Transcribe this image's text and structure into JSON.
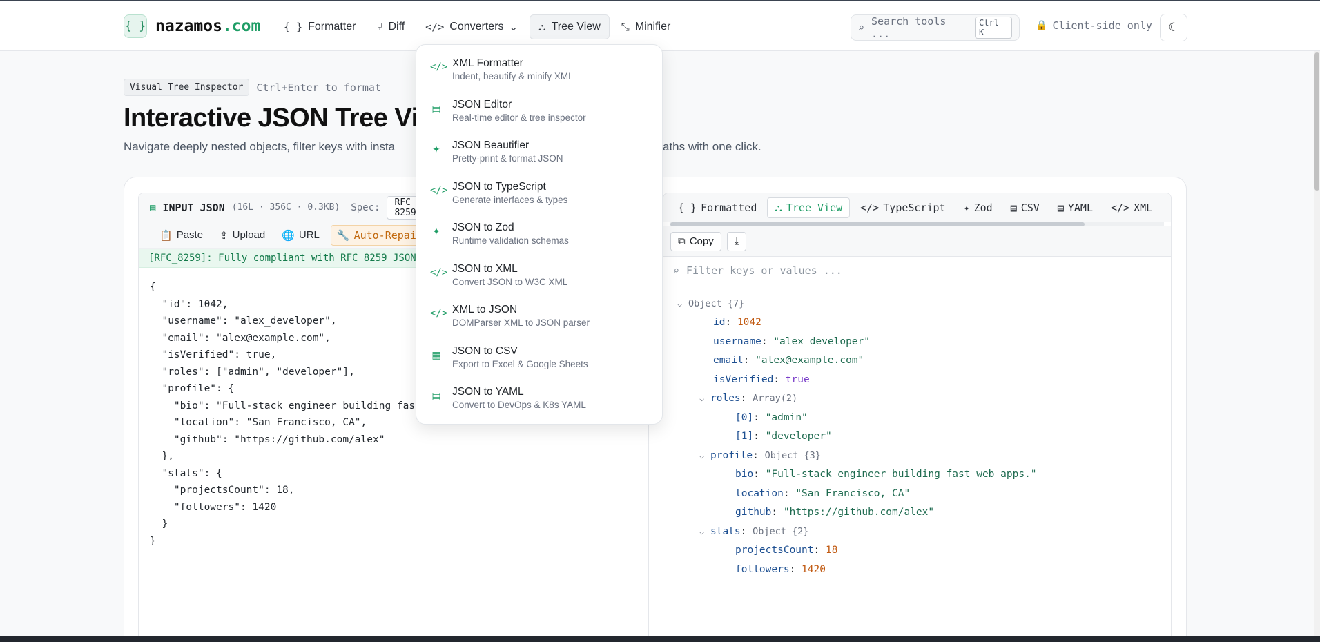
{
  "header": {
    "logo_symbol": "{ }",
    "site_name": "nazamos",
    "site_tld": ".com",
    "nav": [
      {
        "icon": "{ }",
        "label": "Formatter"
      },
      {
        "icon": "⑂",
        "label": "Diff"
      },
      {
        "icon": "</>",
        "label": "Converters",
        "chevron": "⌄"
      },
      {
        "icon": "⛬",
        "label": "Tree View"
      },
      {
        "icon": "⤡",
        "label": "Minifier"
      }
    ],
    "search_placeholder": "Search tools ...",
    "search_shortcut": "Ctrl K",
    "client_only": "Client-side only",
    "theme_icon": "☾"
  },
  "hero": {
    "badge": "Visual Tree Inspector",
    "hint": "Ctrl+Enter to format",
    "title": "Interactive JSON Tree View",
    "description": "Navigate deeply nested objects, filter keys with insta",
    "description_tail": "aths with one click."
  },
  "left_pane": {
    "label": "INPUT JSON",
    "stats": "(16L · 356C · 0.3KB)",
    "spec_label": "Spec:",
    "spec_value": "RFC 8259",
    "tools": [
      {
        "icon": "📋",
        "label": "Paste"
      },
      {
        "icon": "⇪",
        "label": "Upload"
      },
      {
        "icon": "🌐",
        "label": "URL"
      },
      {
        "icon": "🔧",
        "label": "Auto-Repair"
      }
    ],
    "compliance": "[RFC_8259]: Fully compliant with RFC 8259 JSON",
    "code": "{\n  \"id\": 1042,\n  \"username\": \"alex_developer\",\n  \"email\": \"alex@example.com\",\n  \"isVerified\": true,\n  \"roles\": [\"admin\", \"developer\"],\n  \"profile\": {\n    \"bio\": \"Full-stack engineer building fast web apps.\",\n    \"location\": \"San Francisco, CA\",\n    \"github\": \"https://github.com/alex\"\n  },\n  \"stats\": {\n    \"projectsCount\": 18,\n    \"followers\": 1420\n  }\n}"
  },
  "right_pane": {
    "tabs": [
      {
        "icon": "{ }",
        "label": "Formatted"
      },
      {
        "icon": "⛬",
        "label": "Tree View"
      },
      {
        "icon": "</>",
        "label": "TypeScript"
      },
      {
        "icon": "✦",
        "label": "Zod"
      },
      {
        "icon": "▤",
        "label": "CSV"
      },
      {
        "icon": "▤",
        "label": "YAML"
      },
      {
        "icon": "</>",
        "label": "XML"
      }
    ],
    "copy_label": "Copy",
    "download_icon": "⤓",
    "filter_placeholder": "Filter keys or values ...",
    "tree": {
      "root": "Object {7}",
      "id_key": "id",
      "id_val": "1042",
      "username_key": "username",
      "username_val": "\"alex_developer\"",
      "email_key": "email",
      "email_val": "\"alex@example.com\"",
      "verified_key": "isVerified",
      "verified_val": "true",
      "roles_key": "roles",
      "roles_meta": "Array(2)",
      "role0_key": "[0]",
      "role0_val": "\"admin\"",
      "role1_key": "[1]",
      "role1_val": "\"developer\"",
      "profile_key": "profile",
      "profile_meta": "Object {3}",
      "bio_key": "bio",
      "bio_val": "\"Full-stack engineer building fast web apps.\"",
      "location_key": "location",
      "location_val": "\"San Francisco, CA\"",
      "github_key": "github",
      "github_val": "\"https://github.com/alex\"",
      "stats_key": "stats",
      "stats_meta": "Object {2}",
      "projects_key": "projectsCount",
      "projects_val": "18",
      "followers_key": "followers",
      "followers_val": "1420"
    }
  },
  "dropdown": [
    {
      "icon": "</>",
      "title": "XML Formatter",
      "sub": "Indent, beautify & minify XML"
    },
    {
      "icon": "▤",
      "title": "JSON Editor",
      "sub": "Real-time editor & tree inspector"
    },
    {
      "icon": "✦",
      "title": "JSON Beautifier",
      "sub": "Pretty-print & format JSON"
    },
    {
      "icon": "</>",
      "title": "JSON to TypeScript",
      "sub": "Generate interfaces & types"
    },
    {
      "icon": "✦",
      "title": "JSON to Zod",
      "sub": "Runtime validation schemas"
    },
    {
      "icon": "</>",
      "title": "JSON to XML",
      "sub": "Convert JSON to W3C XML"
    },
    {
      "icon": "</>",
      "title": "XML to JSON",
      "sub": "DOMParser XML to JSON parser"
    },
    {
      "icon": "▦",
      "title": "JSON to CSV",
      "sub": "Export to Excel & Google Sheets"
    },
    {
      "icon": "▤",
      "title": "JSON to YAML",
      "sub": "Convert to DevOps & K8s YAML"
    }
  ]
}
